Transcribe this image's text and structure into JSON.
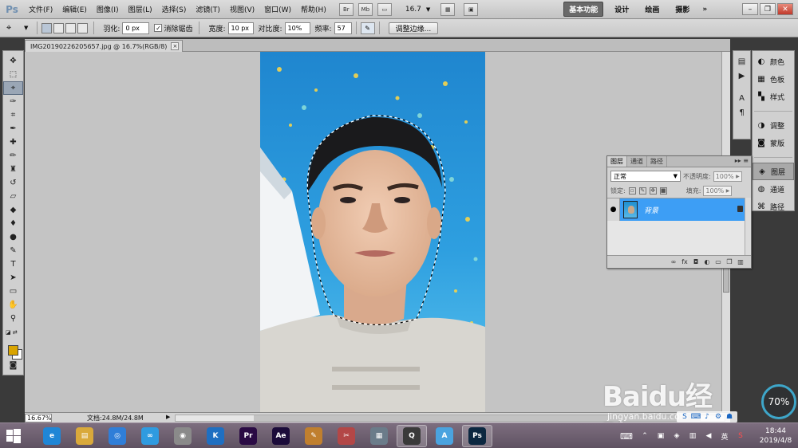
{
  "app": {
    "logo": "Ps",
    "menu": [
      "文件(F)",
      "编辑(E)",
      "图像(I)",
      "图层(L)",
      "选择(S)",
      "滤镜(T)",
      "视图(V)",
      "窗口(W)",
      "帮助(H)"
    ],
    "bridge_label": "Br",
    "minibridge_label": "Mb",
    "zoom_value": "16.7",
    "workspaces": [
      "基本功能",
      "设计",
      "绘画",
      "摄影"
    ],
    "more": "»"
  },
  "options": {
    "feather_label": "羽化:",
    "feather_value": "0 px",
    "antialias_label": "消除锯齿",
    "antialias_checked": "✓",
    "width_label": "宽度:",
    "width_value": "10 px",
    "contrast_label": "对比度:",
    "contrast_value": "10%",
    "frequency_label": "频率:",
    "frequency_value": "57",
    "refine_edge": "调整边缘..."
  },
  "document": {
    "tab_title": "IMG20190226205657.jpg @ 16.7%(RGB/8)",
    "tab_close": "×",
    "zoom": "16.67%",
    "doc_info": "文档:24.8M/24.8M"
  },
  "right_panels": {
    "items": [
      {
        "label": "颜色",
        "icon": "palette-icon",
        "glyph": "◐"
      },
      {
        "label": "色板",
        "icon": "swatches-icon",
        "glyph": "▦"
      },
      {
        "label": "样式",
        "icon": "styles-icon",
        "glyph": "▚"
      },
      {
        "label": "调整",
        "icon": "adjustments-icon",
        "glyph": "◑"
      },
      {
        "label": "蒙版",
        "icon": "masks-icon",
        "glyph": "◙"
      },
      {
        "label": "图层",
        "icon": "layers-icon",
        "glyph": "◈"
      },
      {
        "label": "通道",
        "icon": "channels-icon",
        "glyph": "◍"
      },
      {
        "label": "路径",
        "icon": "paths-icon",
        "glyph": "⌘"
      }
    ],
    "active": "图层"
  },
  "layers": {
    "tabs": [
      "图层",
      "通道",
      "路径"
    ],
    "blend_mode": "正常",
    "opacity_label": "不透明度:",
    "opacity_value": "100%",
    "lock_label": "锁定:",
    "fill_label": "填充:",
    "fill_value": "100%",
    "layer_name": "背景",
    "eye": "●"
  },
  "taskbar": {
    "apps": [
      {
        "name": "ie",
        "glyph": "e",
        "color": "#1f86d6"
      },
      {
        "name": "explorer",
        "glyph": "▤",
        "color": "#d9a93b"
      },
      {
        "name": "browser",
        "glyph": "◎",
        "color": "#2f7ed8"
      },
      {
        "name": "baidu-netdisk",
        "glyph": "∞",
        "color": "#2f9be0"
      },
      {
        "name": "panda",
        "glyph": "◉",
        "color": "#8a8a8a"
      },
      {
        "name": "k-player",
        "glyph": "K",
        "color": "#1f6fc1"
      },
      {
        "name": "premiere",
        "glyph": "Pr",
        "color": "#2a0a44"
      },
      {
        "name": "after-effects",
        "glyph": "Ae",
        "color": "#1b0b3a"
      },
      {
        "name": "paint",
        "glyph": "✎",
        "color": "#c07f2e"
      },
      {
        "name": "tool",
        "glyph": "✂",
        "color": "#b34747"
      },
      {
        "name": "calculator",
        "glyph": "▦",
        "color": "#6b7c8a"
      },
      {
        "name": "qq",
        "glyph": "Q",
        "color": "#3a3a3a"
      },
      {
        "name": "app-a",
        "glyph": "A",
        "color": "#4aa3df"
      },
      {
        "name": "photoshop",
        "glyph": "Ps",
        "color": "#0b2740"
      }
    ],
    "ime": "英",
    "time": "18:44",
    "date": "2019/4/8"
  },
  "overlay": {
    "watermark": "Baidu经验",
    "watermark_url": "jingyan.baidu.com",
    "perf": "70%"
  }
}
